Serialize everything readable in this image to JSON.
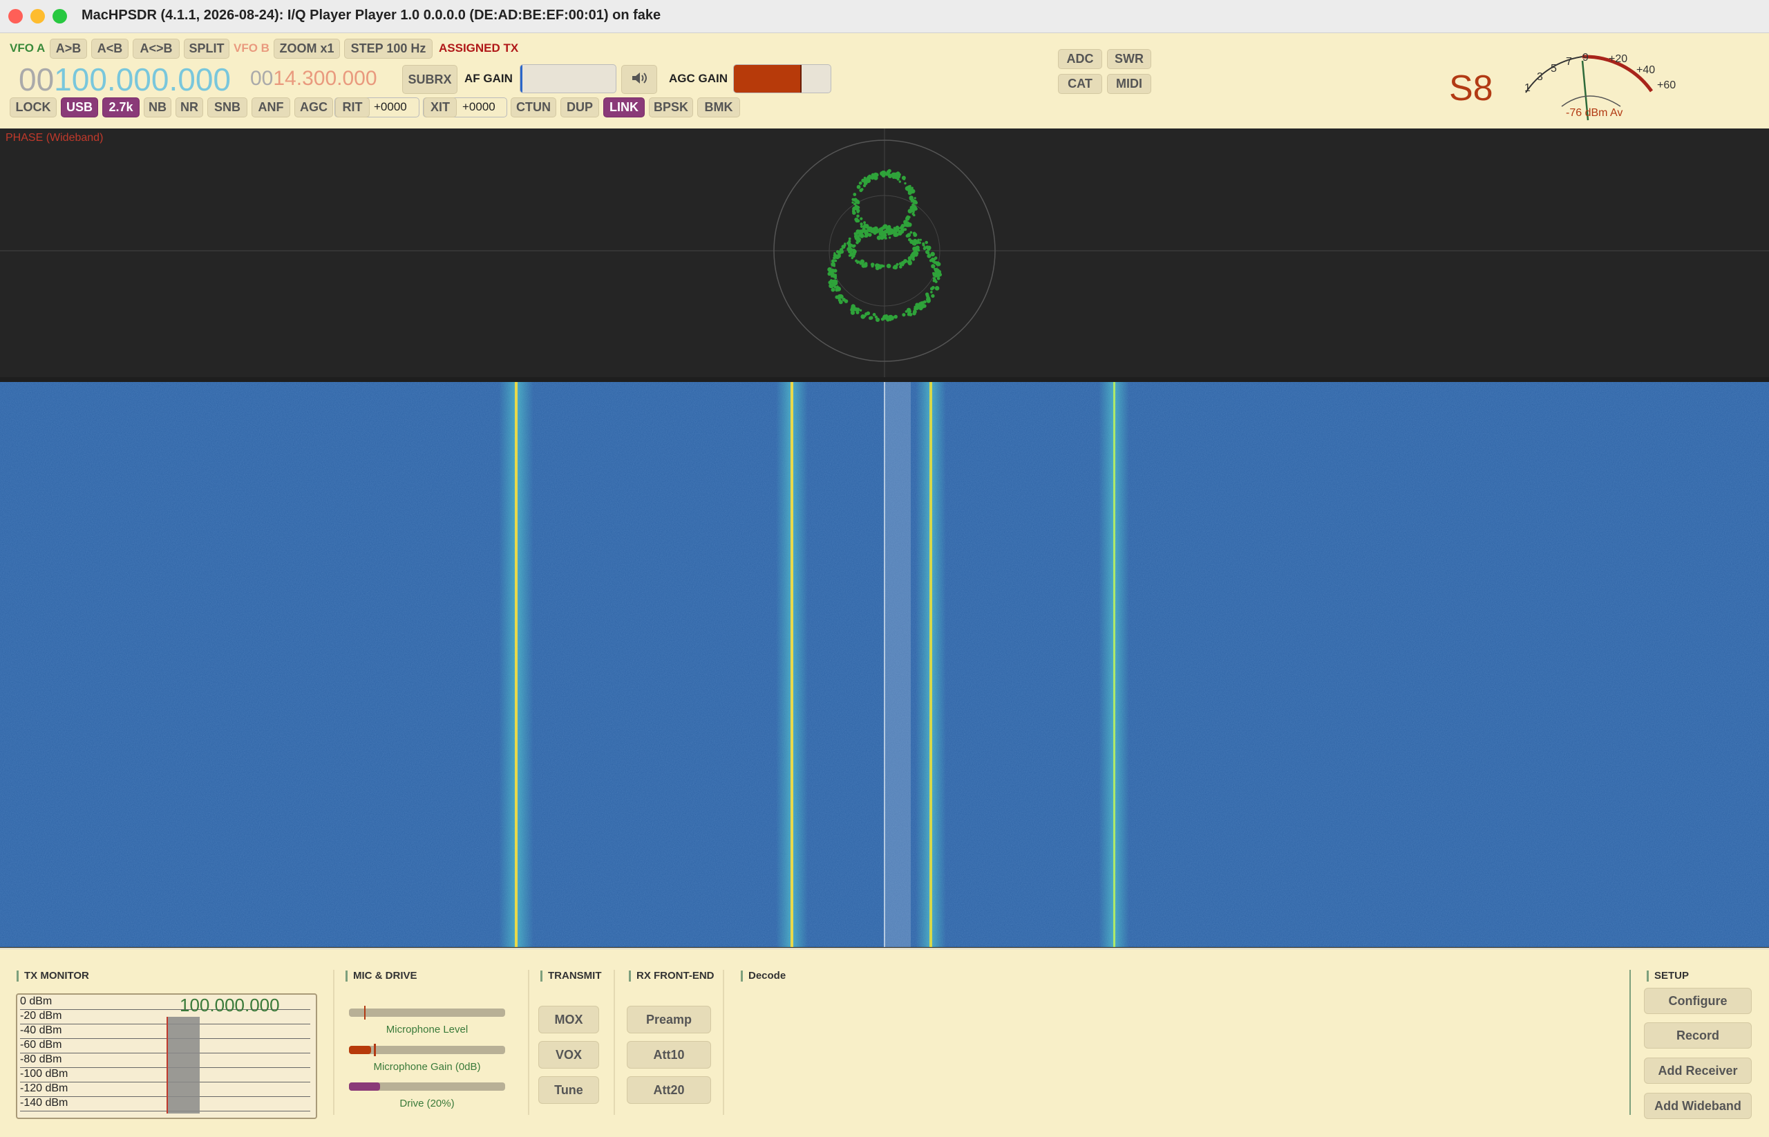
{
  "window": {
    "title": "MacHPSDR (4.1.1, 2026-08-24): I/Q Player Player 1.0 0.0.0.0 (DE:AD:BE:EF:00:01) on fake"
  },
  "vfo": {
    "vfo_a_label": "VFO A",
    "a_to_b": "A>B",
    "b_to_a": "A<B",
    "swap": "A<>B",
    "split": "SPLIT",
    "vfo_b_label": "VFO B",
    "zoom": "ZOOM x1",
    "step": "STEP 100 Hz",
    "assigned_tx": "ASSIGNED TX",
    "freq_a_prefix": "00",
    "freq_a": "100.000.000",
    "freq_b_prefix": "00",
    "freq_b": "14.300.000"
  },
  "controls": {
    "subrx": "SUBRX",
    "af_gain": "AF GAIN",
    "af_gain_level": 0.02,
    "agc_gain": "AGC GAIN",
    "agc_gain_level": 0.7,
    "mute_icon": "speaker-icon"
  },
  "mode_row": {
    "lock": "LOCK",
    "mode": "USB",
    "filter": "2.7k",
    "nb": "NB",
    "nr": "NR",
    "snb": "SNB",
    "anf": "ANF",
    "agc": "AGC",
    "rit": "RIT",
    "rit_value": "+0000",
    "xit": "XIT",
    "xit_value": "+0000",
    "ctun": "CTUN",
    "dup": "DUP",
    "link": "LINK",
    "bpsk": "BPSK",
    "bmk": "BMK"
  },
  "right_buttons": {
    "adc": "ADC",
    "swr": "SWR",
    "cat": "CAT",
    "midi": "MIDI"
  },
  "meter": {
    "s_reading": "S8",
    "scale": [
      "1",
      "3",
      "5",
      "7",
      "9",
      "+20",
      "+40",
      "+60"
    ],
    "avg_text": "-76 dBm Av"
  },
  "display": {
    "phase_label": "PHASE (Wideband)"
  },
  "tx_monitor": {
    "title": "TX MONITOR",
    "freq": "100.000.000",
    "rows": [
      "0 dBm",
      "-20 dBm",
      "-40 dBm",
      "-60 dBm",
      "-80 dBm",
      "-100 dBm",
      "-120 dBm",
      "-140 dBm"
    ]
  },
  "mic_drive": {
    "title": "MIC & DRIVE",
    "mic_level_label": "Microphone Level",
    "mic_gain_label": "Microphone Gain (0dB)",
    "drive_label": "Drive (20%)",
    "drive_level": 0.2
  },
  "transmit": {
    "title": "TRANSMIT",
    "mox": "MOX",
    "vox": "VOX",
    "tune": "Tune"
  },
  "rx_frontend": {
    "title": "RX FRONT-END",
    "preamp": "Preamp",
    "att10": "Att10",
    "att20": "Att20"
  },
  "decode": {
    "title": "Decode"
  },
  "setup": {
    "title": "SETUP",
    "configure": "Configure",
    "record": "Record",
    "add_receiver": "Add Receiver",
    "add_wideband": "Add Wideband"
  },
  "colors": {
    "panel_bg": "#f8efc8",
    "active": "#8a3a78",
    "waterfall": "#2b5fa0",
    "constellation": "#2fa33a",
    "meter_red": "#b23a14"
  }
}
